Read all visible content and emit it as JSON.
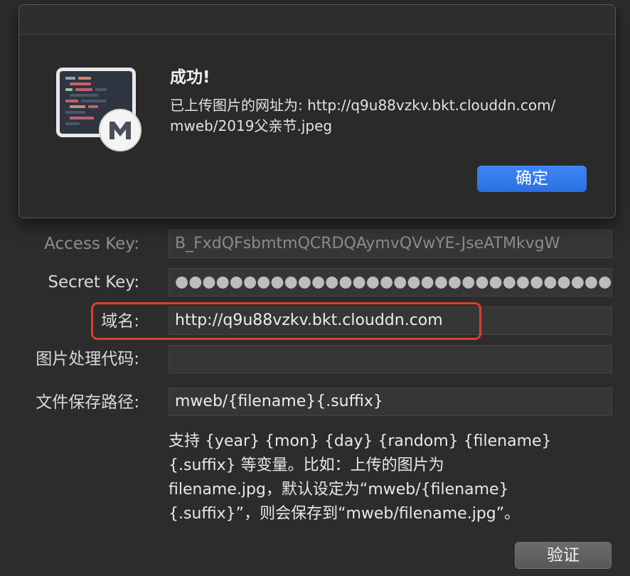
{
  "alert": {
    "title": "成功!",
    "message_line1": "已上传图片的网址为: http://q9u88vzkv.bkt.clouddn.com/",
    "message_line2": "mweb/2019父亲节.jpeg",
    "ok_label": "确定",
    "app_icon": "mweb-app-icon"
  },
  "form": {
    "access_key": {
      "label": "Access Key:",
      "value": "B_FxdQFsbmtmQCRDQAymvQVwYE-JseATMkvgW"
    },
    "secret_key": {
      "label": "Secret Key:",
      "value": "●●●●●●●●●●●●●●●●●●●●●●●●●●●●●●●●●●●●●●●●●●●●●●●●"
    },
    "domain": {
      "label": "域名:",
      "value": "http://q9u88vzkv.bkt.clouddn.com"
    },
    "image_process": {
      "label": "图片处理代码:",
      "value": ""
    },
    "save_path": {
      "label": "文件保存路径:",
      "value": "mweb/{filename}{.suffix}"
    },
    "hint_lines": [
      "支持 {year} {mon} {day} {random} {filename}",
      "{.suffix} 等变量。比如：上传的图片为",
      "filename.jpg，默认设定为“mweb/{filename}",
      "{.suffix}”，则会保存到“mweb/filename.jpg”。"
    ],
    "verify_label": "验证"
  },
  "colors": {
    "highlight_border": "#d9402f",
    "primary_button": "#2f74e6"
  }
}
